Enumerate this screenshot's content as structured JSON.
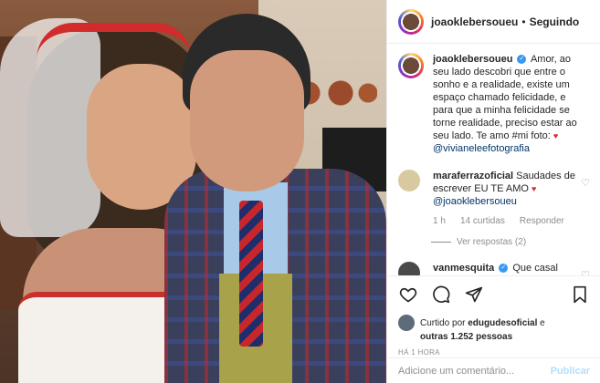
{
  "post": {
    "author": "joaoklebersoueu",
    "follow_status": "Seguindo",
    "dot": "•"
  },
  "caption": {
    "username": "joaoklebersoueu",
    "text": "Amor, ao seu lado descobri que entre o sonho e a realidade, existe um espaço chamado felicidade, e para que a minha felicidade se torne realidade, preciso estar ao seu lado. Te amo #mi foto:",
    "mention": "@vivianeleefotografia"
  },
  "comments": [
    {
      "username": "maraferrazoficial",
      "text": "Saudades de escrever EU TE AMO",
      "mention": "@joaoklebersoueu",
      "time": "1 h",
      "likes": "14 curtidas",
      "reply": "Responder",
      "view_replies": "Ver respostas (2)"
    },
    {
      "username": "vanmesquita",
      "text": "Que casal mais lindo esse"
    }
  ],
  "likes": {
    "prefix": "Curtido por",
    "user": "edugudesoficial",
    "conj": "e",
    "others": "outras 1.252 pessoas"
  },
  "time_ago": "HÁ 1 HORA",
  "add_comment": {
    "placeholder": "Adicione um comentário...",
    "publish": "Publicar"
  }
}
